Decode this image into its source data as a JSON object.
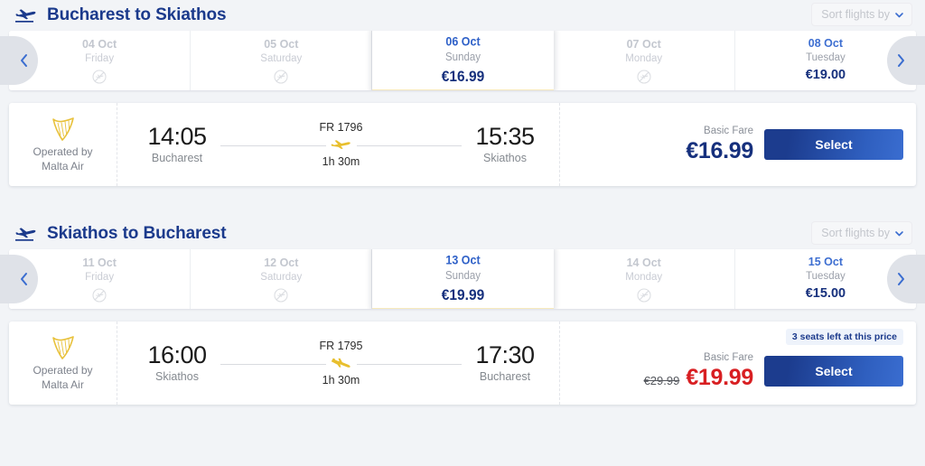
{
  "sections": [
    {
      "title": "Bucharest to Skiathos",
      "sort_label": "Sort flights by",
      "dates": [
        {
          "date": "04 Oct",
          "day": "Friday",
          "price": "",
          "state": "no-flight"
        },
        {
          "date": "05 Oct",
          "day": "Saturday",
          "price": "",
          "state": "no-flight"
        },
        {
          "date": "06 Oct",
          "day": "Sunday",
          "price": "€16.99",
          "state": "selected"
        },
        {
          "date": "07 Oct",
          "day": "Monday",
          "price": "",
          "state": "no-flight"
        },
        {
          "date": "08 Oct",
          "day": "Tuesday",
          "price": "€19.00",
          "state": "available"
        }
      ],
      "flight": {
        "operated_by_line1": "Operated by",
        "operated_by_line2": "Malta Air",
        "depart_time": "14:05",
        "depart_city": "Bucharest",
        "flight_number": "FR 1796",
        "duration": "1h 30m",
        "arrive_time": "15:35",
        "arrive_city": "Skiathos",
        "fare_label": "Basic Fare",
        "fare_old": "",
        "fare_amount": "€16.99",
        "on_sale": false,
        "seats_badge": "",
        "select_label": "Select"
      }
    },
    {
      "title": "Skiathos to Bucharest",
      "sort_label": "Sort flights by",
      "dates": [
        {
          "date": "11 Oct",
          "day": "Friday",
          "price": "",
          "state": "no-flight"
        },
        {
          "date": "12 Oct",
          "day": "Saturday",
          "price": "",
          "state": "no-flight"
        },
        {
          "date": "13 Oct",
          "day": "Sunday",
          "price": "€19.99",
          "state": "selected"
        },
        {
          "date": "14 Oct",
          "day": "Monday",
          "price": "",
          "state": "no-flight"
        },
        {
          "date": "15 Oct",
          "day": "Tuesday",
          "price": "€15.00",
          "state": "available"
        }
      ],
      "flight": {
        "operated_by_line1": "Operated by",
        "operated_by_line2": "Malta Air",
        "depart_time": "16:00",
        "depart_city": "Skiathos",
        "flight_number": "FR 1795",
        "duration": "1h 30m",
        "arrive_time": "17:30",
        "arrive_city": "Bucharest",
        "fare_label": "Basic Fare",
        "fare_old": "€29.99",
        "fare_amount": "€19.99",
        "on_sale": true,
        "seats_badge": "3 seats left at this price",
        "select_label": "Select"
      }
    }
  ],
  "icons": {
    "section_plane": "takeoff-plane-icon",
    "prev": "chevron-left-icon",
    "next": "chevron-right-icon",
    "sort_chevron": "chevron-down-icon",
    "no_flight": "no-flight-icon",
    "airline_logo": "ryanair-harp-logo",
    "route_plane": "plane-icon"
  },
  "colors": {
    "brand_navy": "#16307d",
    "accent_blue": "#3a6dd0",
    "selected_underline": "#e8b81f",
    "sale_red": "#d81f22",
    "page_bg": "#f2f4f7"
  }
}
